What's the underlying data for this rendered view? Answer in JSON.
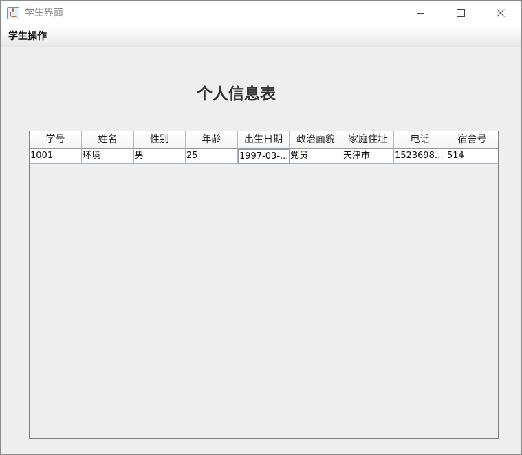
{
  "window": {
    "title": "学生界面",
    "icon": "java-cup-icon"
  },
  "menubar": {
    "items": [
      {
        "label": "学生操作"
      }
    ]
  },
  "main": {
    "heading": "个人信息表"
  },
  "table": {
    "columns": [
      "学号",
      "姓名",
      "性别",
      "年龄",
      "出生日期",
      "政治面貌",
      "家庭住址",
      "电话",
      "宿舍号"
    ],
    "rows": [
      [
        "1001",
        "环境",
        "男",
        "25",
        "1997-03-...",
        "党员",
        "天津市",
        "15236987...",
        "514"
      ]
    ]
  }
}
